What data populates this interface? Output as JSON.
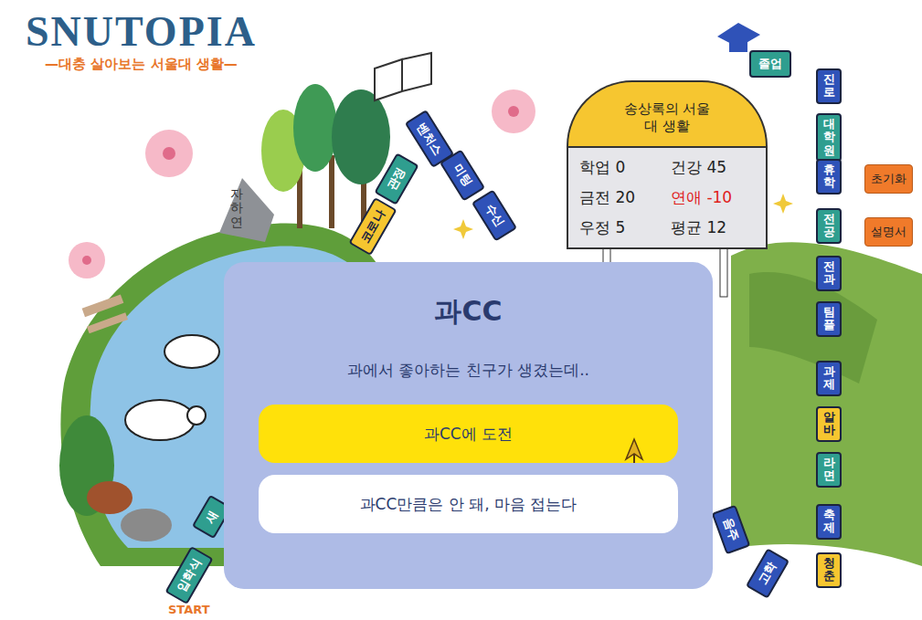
{
  "logo": {
    "title": "SNUTOPIA",
    "subtitle": "—대충 살아보는 서울대 생활—"
  },
  "board": {
    "start": "START",
    "landmark": "자하연",
    "goal": "졸업",
    "path_tiles": [
      {
        "label": "입학식",
        "color": "#2f9e8f"
      },
      {
        "label": "새",
        "color": "#2f9e8f"
      },
      {
        "label": "코로나",
        "color": "#f6c630"
      },
      {
        "label": "관정",
        "color": "#2f9e8f"
      },
      {
        "label": "벤처스",
        "color": "#2f52b8"
      },
      {
        "label": "미팅",
        "color": "#2f52b8"
      },
      {
        "label": "수신",
        "color": "#2f52b8"
      }
    ],
    "side_tiles": [
      {
        "label": "진로",
        "color": "#2f52b8"
      },
      {
        "label": "대학원",
        "color": "#2f9e8f"
      },
      {
        "label": "휴학",
        "color": "#2f52b8"
      },
      {
        "label": "전공",
        "color": "#2f9e8f"
      },
      {
        "label": "전과",
        "color": "#2f52b8"
      },
      {
        "label": "팀플",
        "color": "#2f52b8"
      },
      {
        "label": "과제",
        "color": "#2f52b8"
      },
      {
        "label": "알바",
        "color": "#f6c630"
      },
      {
        "label": "라면",
        "color": "#2f9e8f"
      },
      {
        "label": "축제",
        "color": "#2f52b8"
      },
      {
        "label": "청춘",
        "color": "#f6c630"
      }
    ],
    "bottom_tiles": [
      {
        "label": "음주",
        "color": "#2f52b8"
      },
      {
        "label": "고학",
        "color": "#2f52b8"
      }
    ]
  },
  "status_board": {
    "title": "송상록의 서울대 생활",
    "stats": [
      {
        "label": "학업",
        "value": "0",
        "negative": false
      },
      {
        "label": "건강",
        "value": "45",
        "negative": false
      },
      {
        "label": "금전",
        "value": "20",
        "negative": false
      },
      {
        "label": "연애",
        "value": "-10",
        "negative": true
      },
      {
        "label": "우정",
        "value": "5",
        "negative": false
      },
      {
        "label": "평균",
        "value": "12",
        "negative": false
      }
    ]
  },
  "side_buttons": [
    "초기화",
    "설명서"
  ],
  "modal": {
    "title": "과CC",
    "description": "과에서 좋아하는 친구가 생겼는데..",
    "options": [
      {
        "label": "과CC에 도전",
        "selected": true
      },
      {
        "label": "과CC만큼은 안 돼, 마음 접는다",
        "selected": false
      }
    ]
  }
}
